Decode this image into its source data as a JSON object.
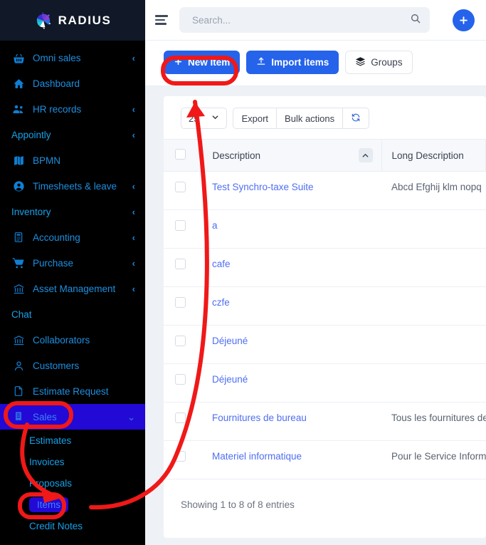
{
  "brand": {
    "name": "RADIUS",
    "logo_icon": "pinwheel-logo-icon"
  },
  "sidebar": {
    "items": [
      {
        "label": "Omni sales",
        "icon": "basket-icon",
        "chevron": "‹",
        "kind": "item"
      },
      {
        "label": "Dashboard",
        "icon": "home-icon",
        "chevron": "",
        "kind": "item"
      },
      {
        "label": "HR records",
        "icon": "users-icon",
        "chevron": "‹",
        "kind": "item"
      },
      {
        "label": "Appointly",
        "icon": "",
        "chevron": "‹",
        "kind": "section"
      },
      {
        "label": "BPMN",
        "icon": "book-icon",
        "chevron": "",
        "kind": "item"
      },
      {
        "label": "Timesheets & leave",
        "icon": "user-circle-icon",
        "chevron": "‹",
        "kind": "item"
      },
      {
        "label": "Inventory",
        "icon": "",
        "chevron": "‹",
        "kind": "section"
      },
      {
        "label": "Accounting",
        "icon": "calculator-icon",
        "chevron": "‹",
        "kind": "item"
      },
      {
        "label": "Purchase",
        "icon": "cart-icon",
        "chevron": "‹",
        "kind": "item"
      },
      {
        "label": "Asset Management",
        "icon": "bank-icon",
        "chevron": "‹",
        "kind": "item"
      },
      {
        "label": "Chat",
        "icon": "",
        "chevron": "",
        "kind": "section"
      },
      {
        "label": "Collaborators",
        "icon": "bank-icon",
        "chevron": "",
        "kind": "item"
      },
      {
        "label": "Customers",
        "icon": "person-icon",
        "chevron": "",
        "kind": "item"
      },
      {
        "label": "Estimate Request",
        "icon": "file-icon",
        "chevron": "",
        "kind": "item"
      },
      {
        "label": "Sales",
        "icon": "receipt-icon",
        "chevron": "⌄",
        "kind": "item-active"
      }
    ],
    "sub_items": [
      {
        "label": "Estimates",
        "active": false
      },
      {
        "label": "Invoices",
        "active": false
      },
      {
        "label": "Proposals",
        "active": false
      },
      {
        "label": "Items",
        "active": true
      },
      {
        "label": "Credit Notes",
        "active": false
      }
    ]
  },
  "topbar": {
    "menu_icon": "hamburger-icon",
    "search_placeholder": "Search...",
    "search_value": "",
    "search_icon": "search-icon",
    "add_icon": "plus-icon"
  },
  "actions": {
    "new_item_label": "New Item",
    "new_item_icon": "plus-icon",
    "import_label": "Import items",
    "import_icon": "upload-icon",
    "groups_label": "Groups",
    "groups_icon": "layers-icon"
  },
  "table_tools": {
    "page_size": "25",
    "page_size_caret": "chevron-down-icon",
    "export_label": "Export",
    "bulk_label": "Bulk actions",
    "refresh_icon": "refresh-icon"
  },
  "table": {
    "columns": [
      "Description",
      "Long Description"
    ],
    "sort_column": "Description",
    "sort_direction_icon": "chevron-up-icon",
    "rows": [
      {
        "description": "Test Synchro-taxe Suite",
        "long_description": "Abcd Efghij klm nopq"
      },
      {
        "description": "a",
        "long_description": ""
      },
      {
        "description": "cafe",
        "long_description": ""
      },
      {
        "description": "czfe",
        "long_description": ""
      },
      {
        "description": "Déjeuné",
        "long_description": ""
      },
      {
        "description": "Déjeuné",
        "long_description": ""
      },
      {
        "description": "Fournitures de bureau",
        "long_description": "Tous les fournitures de"
      },
      {
        "description": "Materiel informatique",
        "long_description": "Pour le Service Informa"
      }
    ],
    "footer": "Showing 1 to 8 of 8 entries"
  },
  "annotations": {
    "color": "#f01818",
    "highlight_sales": "Sales",
    "highlight_items": "Items",
    "highlight_new_item": "New Item"
  },
  "colors": {
    "sidebar_bg": "#000000",
    "logo_bg": "#111827",
    "active_nav": "#2209d6",
    "primary_blue": "#2563eb",
    "link_blue": "#4f6ef2",
    "page_bg": "#eef1f6",
    "annotation_red": "#f01818"
  }
}
